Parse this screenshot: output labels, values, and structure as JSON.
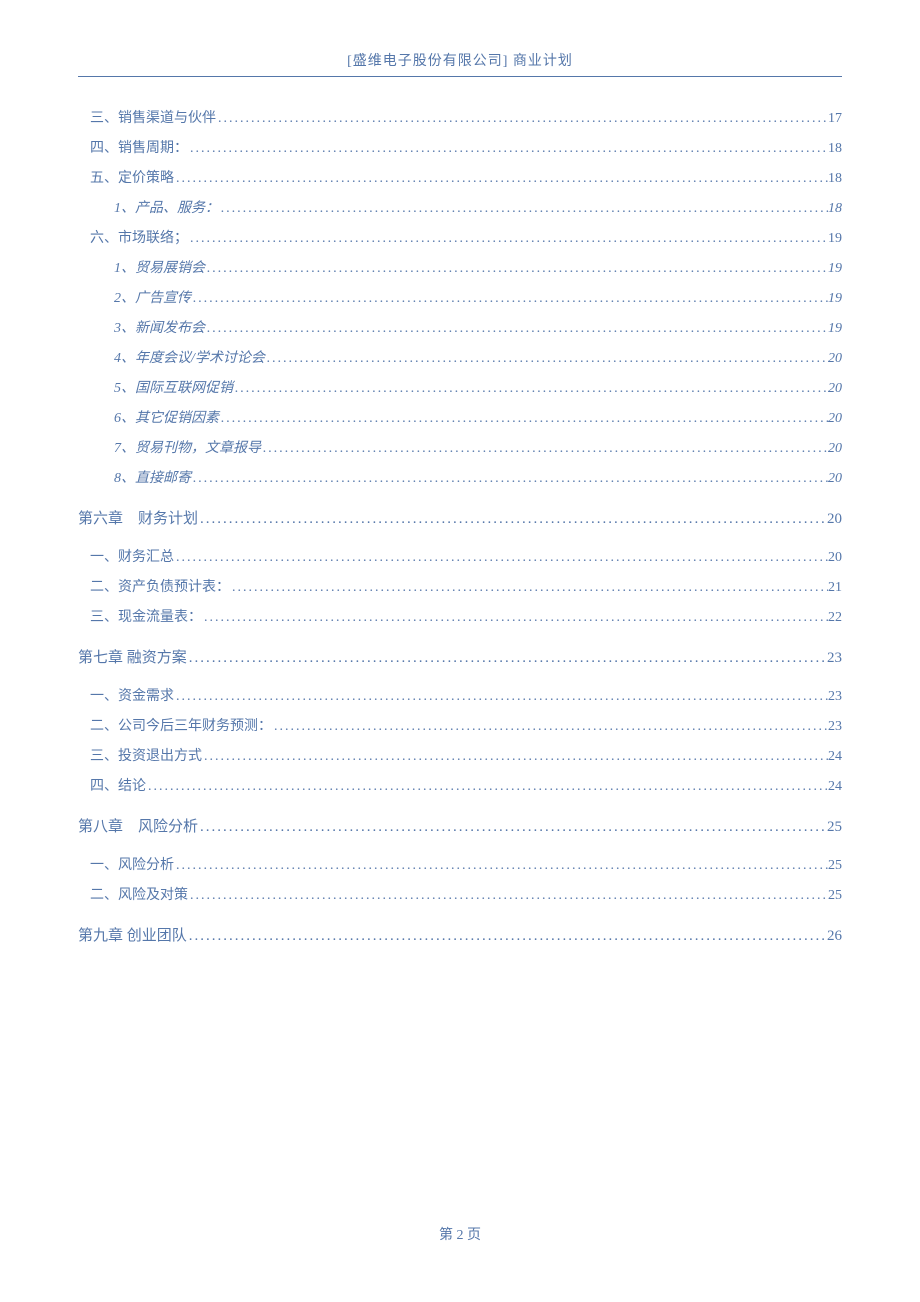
{
  "header": {
    "title": "[盛维电子股份有限公司] 商业计划"
  },
  "toc": {
    "pre_sections": [
      {
        "label": "三、销售渠道与伙伴",
        "page": "17",
        "level": 1
      },
      {
        "label": "四、销售周期：",
        "page": "18",
        "level": 1
      },
      {
        "label": "五、定价策略",
        "page": "18",
        "level": 1
      },
      {
        "label": "1、产品、服务：",
        "page": "18",
        "level": 2
      },
      {
        "label": "六、市场联络；",
        "page": "19",
        "level": 1
      },
      {
        "label": "1、贸易展销会",
        "page": "19",
        "level": 2
      },
      {
        "label": "2、广告宣传",
        "page": "19",
        "level": 2
      },
      {
        "label": "3、新闻发布会",
        "page": "19",
        "level": 2
      },
      {
        "label": "4、年度会议/学术讨论会",
        "page": "20",
        "level": 2
      },
      {
        "label": "5、国际互联网促销",
        "page": "20",
        "level": 2
      },
      {
        "label": "6、其它促销因素",
        "page": "20",
        "level": 2
      },
      {
        "label": "7、贸易刊物，文章报导",
        "page": "20",
        "level": 2
      },
      {
        "label": "8、直接邮寄",
        "page": "20",
        "level": 2
      }
    ],
    "chapters": [
      {
        "title": "第六章　财务计划",
        "page": "20",
        "sections": [
          {
            "label": "一、财务汇总",
            "page": "20",
            "level": 1
          },
          {
            "label": "二、资产负债预计表：",
            "page": "21",
            "level": 1
          },
          {
            "label": "三、现金流量表：",
            "page": "22",
            "level": 1
          }
        ]
      },
      {
        "title": "第七章 融资方案",
        "page": "23",
        "sections": [
          {
            "label": "一、资金需求",
            "page": "23",
            "level": 1
          },
          {
            "label": "二、公司今后三年财务预测：",
            "page": "23",
            "level": 1
          },
          {
            "label": "三、投资退出方式",
            "page": "24",
            "level": 1
          },
          {
            "label": "四、结论",
            "page": "24",
            "level": 1
          }
        ]
      },
      {
        "title": "第八章　风险分析",
        "page": "25",
        "sections": [
          {
            "label": "一、风险分析",
            "page": "25",
            "level": 1
          },
          {
            "label": "二、风险及对策",
            "page": "25",
            "level": 1
          }
        ]
      },
      {
        "title": "第九章 创业团队",
        "page": "26",
        "sections": []
      }
    ]
  },
  "footer": {
    "page_label": "第 2 页"
  }
}
